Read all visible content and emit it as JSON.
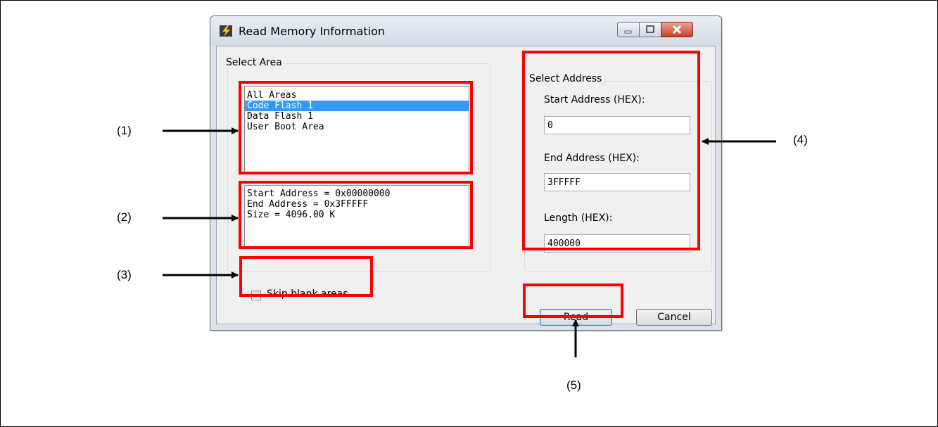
{
  "dialog": {
    "title": "Read Memory Information",
    "select_area": {
      "label": "Select Area",
      "areas": [
        "All Areas",
        "Code Flash 1",
        "Data Flash 1",
        "User Boot Area"
      ],
      "selected": "Code Flash 1",
      "info": [
        "Start Address = 0x00000000",
        "End Address = 0x3FFFFF",
        "Size = 4096.00 K"
      ]
    },
    "skip_blank": {
      "label": "Skip blank areas",
      "checked": false
    },
    "select_address": {
      "label": "Select Address",
      "start_label": "Start Address (HEX):",
      "start_value": "0",
      "end_label": "End Address (HEX):",
      "end_value": "3FFFFF",
      "length_label": "Length (HEX):",
      "length_value": "400000"
    },
    "buttons": {
      "read": "Read",
      "cancel": "Cancel"
    }
  },
  "callouts": [
    "(1)",
    "(2)",
    "(3)",
    "(4)",
    "(5)"
  ],
  "colors": {
    "highlight": "#ff0000",
    "selection": "#3399ff"
  }
}
